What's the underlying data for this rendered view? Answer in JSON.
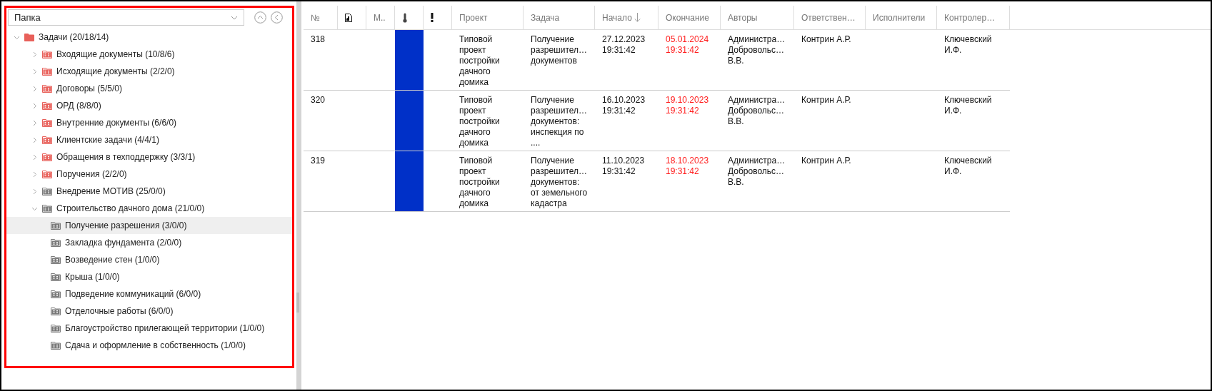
{
  "folder_select": {
    "value": "Папка"
  },
  "tree": [
    {
      "label": "Задачи (20/18/14)",
      "color": "#e8605a",
      "expanded": true,
      "selected": false,
      "children": [
        {
          "label": "Входящие документы (10/8/6)",
          "color": "#e8605a",
          "expanded": false,
          "selected": false
        },
        {
          "label": "Исходящие документы (2/2/0)",
          "color": "#e8605a",
          "expanded": false,
          "selected": false
        },
        {
          "label": "Договоры (5/5/0)",
          "color": "#e8605a",
          "expanded": false,
          "selected": false
        },
        {
          "label": "ОРД (8/8/0)",
          "color": "#e8605a",
          "expanded": false,
          "selected": false
        },
        {
          "label": "Внутренние документы (6/6/0)",
          "color": "#e8605a",
          "expanded": false,
          "selected": false
        },
        {
          "label": "Клиентские задачи (4/4/1)",
          "color": "#e8605a",
          "expanded": false,
          "selected": false
        },
        {
          "label": "Обращения в техподдержку (3/3/1)",
          "color": "#e8605a",
          "expanded": false,
          "selected": false
        },
        {
          "label": "Поручения (2/2/0)",
          "color": "#e8605a",
          "expanded": false,
          "selected": false
        },
        {
          "label": "Внедрение МОТИВ (25/0/0)",
          "color": "#7a7a7a",
          "expanded": false,
          "selected": false
        },
        {
          "label": "Строительство дачного дома (21/0/0)",
          "color": "#7a7a7a",
          "expanded": true,
          "selected": false,
          "children": [
            {
              "label": "Получение разрешения (3/0/0)",
              "color": "#7a7a7a",
              "selected": true
            },
            {
              "label": "Закладка фундамента (2/0/0)",
              "color": "#7a7a7a",
              "selected": false
            },
            {
              "label": "Возведение стен (1/0/0)",
              "color": "#7a7a7a",
              "selected": false
            },
            {
              "label": "Крыша (1/0/0)",
              "color": "#7a7a7a",
              "selected": false
            },
            {
              "label": "Подведение коммуникаций (6/0/0)",
              "color": "#7a7a7a",
              "selected": false
            },
            {
              "label": "Отделочные работы (6/0/0)",
              "color": "#7a7a7a",
              "selected": false
            },
            {
              "label": "Благоустройство прилегающей территории (1/0/0)",
              "color": "#7a7a7a",
              "selected": false
            },
            {
              "label": "Сдача и оформление в собственность (1/0/0)",
              "color": "#7a7a7a",
              "selected": false
            }
          ]
        }
      ]
    }
  ],
  "table": {
    "columns": [
      {
        "kind": "text",
        "label": "№",
        "sorted": false
      },
      {
        "kind": "document",
        "sorted": false
      },
      {
        "kind": "text",
        "label": "М..",
        "sorted": false
      },
      {
        "kind": "thermometer",
        "sorted": false
      },
      {
        "kind": "exclamation",
        "sorted": false
      },
      {
        "kind": "text",
        "label": "Проект",
        "sorted": false
      },
      {
        "kind": "text",
        "label": "Задача",
        "sorted": false
      },
      {
        "kind": "text",
        "label": "Начало",
        "sorted": true
      },
      {
        "kind": "text",
        "label": "Окончание",
        "sorted": false
      },
      {
        "kind": "text",
        "label": "Авторы",
        "sorted": false
      },
      {
        "kind": "text",
        "label": "Ответствен…",
        "sorted": false
      },
      {
        "kind": "text",
        "label": "Исполнители",
        "sorted": false
      },
      {
        "kind": "text",
        "label": "Контролер…",
        "sorted": false
      }
    ],
    "rows": [
      {
        "number": "318",
        "color": "#0030c8",
        "project": "Типовой проект постройки дачного домика",
        "task": "Получение разрешител… документов",
        "start": "27.12.2023 19:31:42",
        "end": "05.01.2024 19:31:42",
        "overdue": true,
        "authors": [
          "Администра…",
          "Добровольс… В.В."
        ],
        "responsible": "Контрин А.Р.",
        "controller": "Ключевский И.Ф."
      },
      {
        "number": "320",
        "color": "#0030c8",
        "project": "Типовой проект постройки дачного домика",
        "task": "Получение разрешител… документов: инспекция по ....",
        "start": "16.10.2023 19:31:42",
        "end": "19.10.2023 19:31:42",
        "overdue": true,
        "authors": [
          "Администра…",
          "Добровольс… В.В."
        ],
        "responsible": "Контрин А.Р.",
        "controller": "Ключевский И.Ф."
      },
      {
        "number": "319",
        "color": "#0030c8",
        "project": "Типовой проект постройки дачного домика",
        "task": "Получение разрешител… документов: от земельного кадастра",
        "start": "11.10.2023 19:31:42",
        "end": "18.10.2023 19:31:42",
        "overdue": true,
        "authors": [
          "Администра…",
          "Добровольс… В.В."
        ],
        "responsible": "Контрин А.Р.",
        "controller": "Ключевский И.Ф."
      }
    ]
  }
}
